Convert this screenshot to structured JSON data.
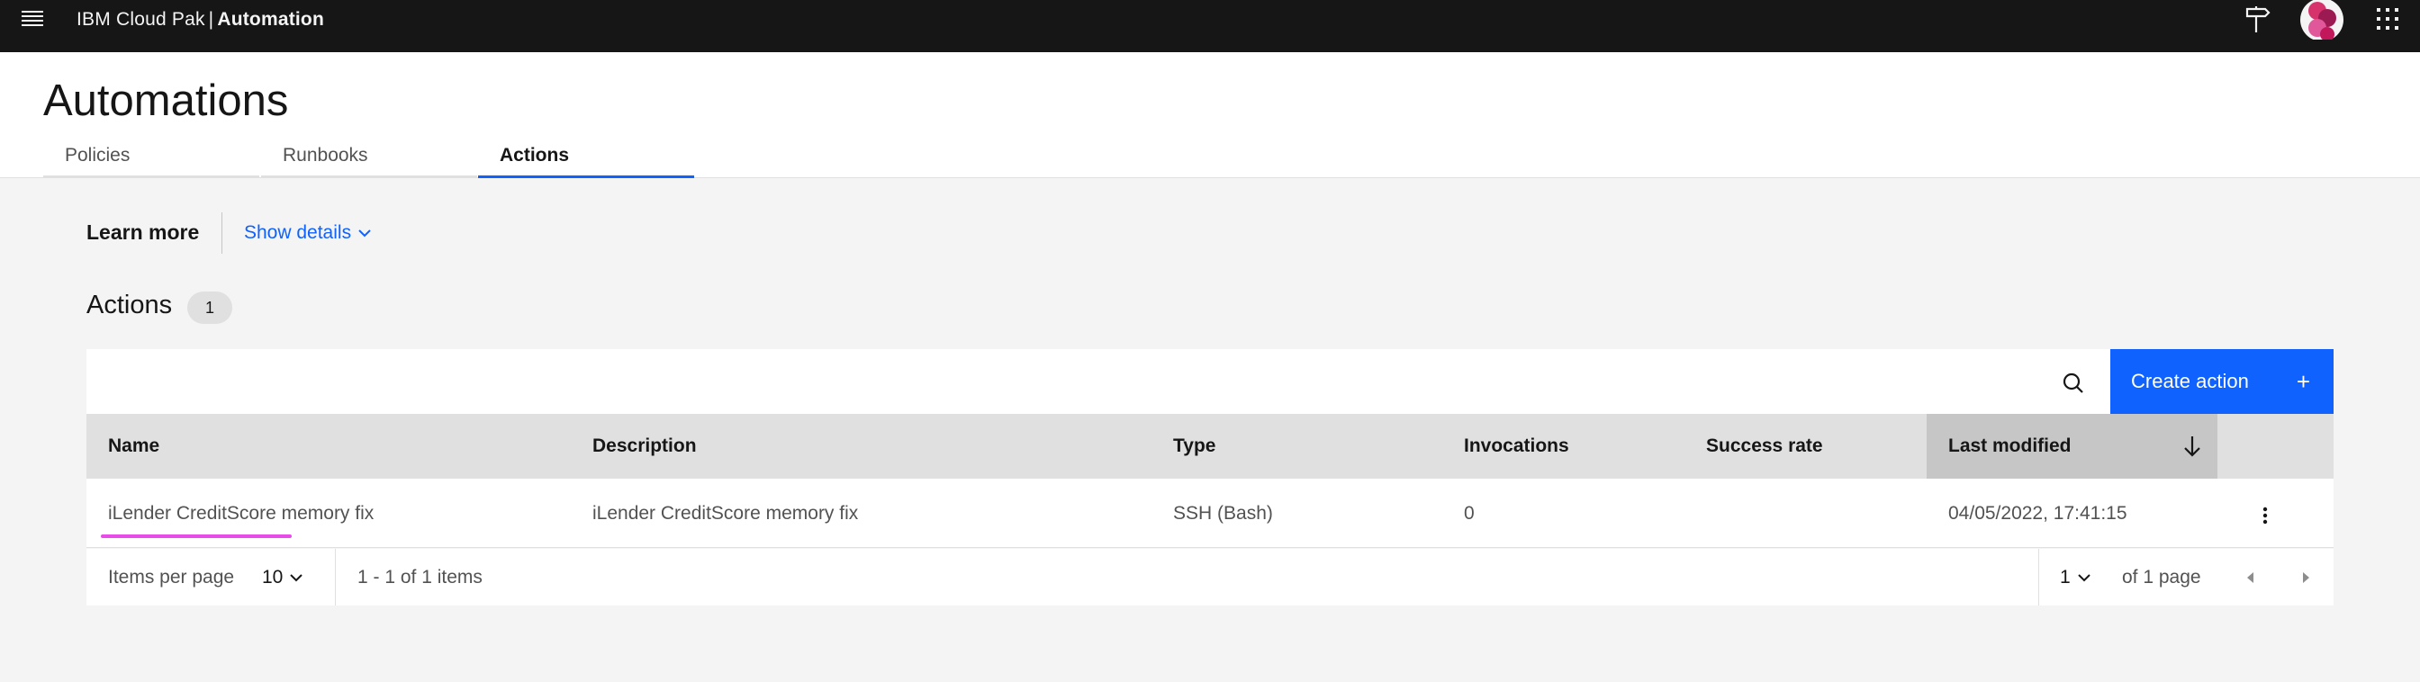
{
  "header": {
    "brand_prefix": "IBM Cloud Pak",
    "brand_separator": "|",
    "brand_product": "Automation",
    "icons": [
      "menu-icon",
      "signpost-icon",
      "avatar-icon",
      "app-switcher-icon"
    ]
  },
  "page": {
    "title": "Automations",
    "tabs": [
      {
        "label": "Policies",
        "active": false
      },
      {
        "label": "Runbooks",
        "active": false
      },
      {
        "label": "Actions",
        "active": true
      }
    ]
  },
  "learn_more": {
    "label": "Learn more",
    "toggle_label": "Show details"
  },
  "section": {
    "title": "Actions",
    "count": "1"
  },
  "toolbar": {
    "search_icon": "search-icon",
    "create_label": "Create action",
    "create_icon": "+"
  },
  "table": {
    "columns": [
      "Name",
      "Description",
      "Type",
      "Invocations",
      "Success rate",
      "Last modified"
    ],
    "sorted_column": "Last modified",
    "sort_direction": "descending",
    "rows": [
      {
        "name": "iLender CreditScore memory fix",
        "description": "iLender CreditScore memory fix",
        "type": "SSH (Bash)",
        "invocations": "0",
        "success_rate": "",
        "last_modified": "04/05/2022, 17:41:15"
      }
    ]
  },
  "pagination": {
    "items_per_page_label": "Items per page",
    "items_per_page_value": "10",
    "range_text": "1 - 1 of 1 items",
    "page_value": "1",
    "page_total_text": "of 1 page"
  },
  "colors": {
    "accent": "#0f62fe",
    "header_bg": "#161616",
    "highlight_mark": "#e84ce8"
  }
}
